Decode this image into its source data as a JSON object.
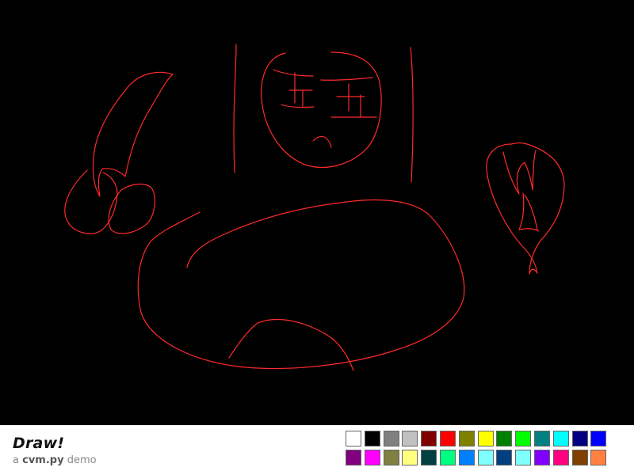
{
  "app": {
    "title": "Draw!",
    "subtitle_prefix": "a ",
    "subtitle_brand": "cvm.py",
    "subtitle_suffix": " demo"
  },
  "canvas": {
    "background": "#000000",
    "stroke_color": "#ff2a2a"
  },
  "palette": {
    "row1": [
      "#ffffff",
      "#000000",
      "#808080",
      "#c0c0c0",
      "#800000",
      "#ff0000",
      "#808000",
      "#ffff00",
      "#008000",
      "#00ff00",
      "#008080",
      "#00ffff",
      "#000080",
      "#0000ff"
    ],
    "row2": [
      "#800080",
      "#ff00ff",
      "#808040",
      "#ffff80",
      "#004040",
      "#00ff80",
      "#0080ff",
      "#80ffff",
      "#004080",
      "#80ffff",
      "#8000ff",
      "#ff0080",
      "#804000",
      "#ff8040"
    ],
    "selected_index": 0
  }
}
